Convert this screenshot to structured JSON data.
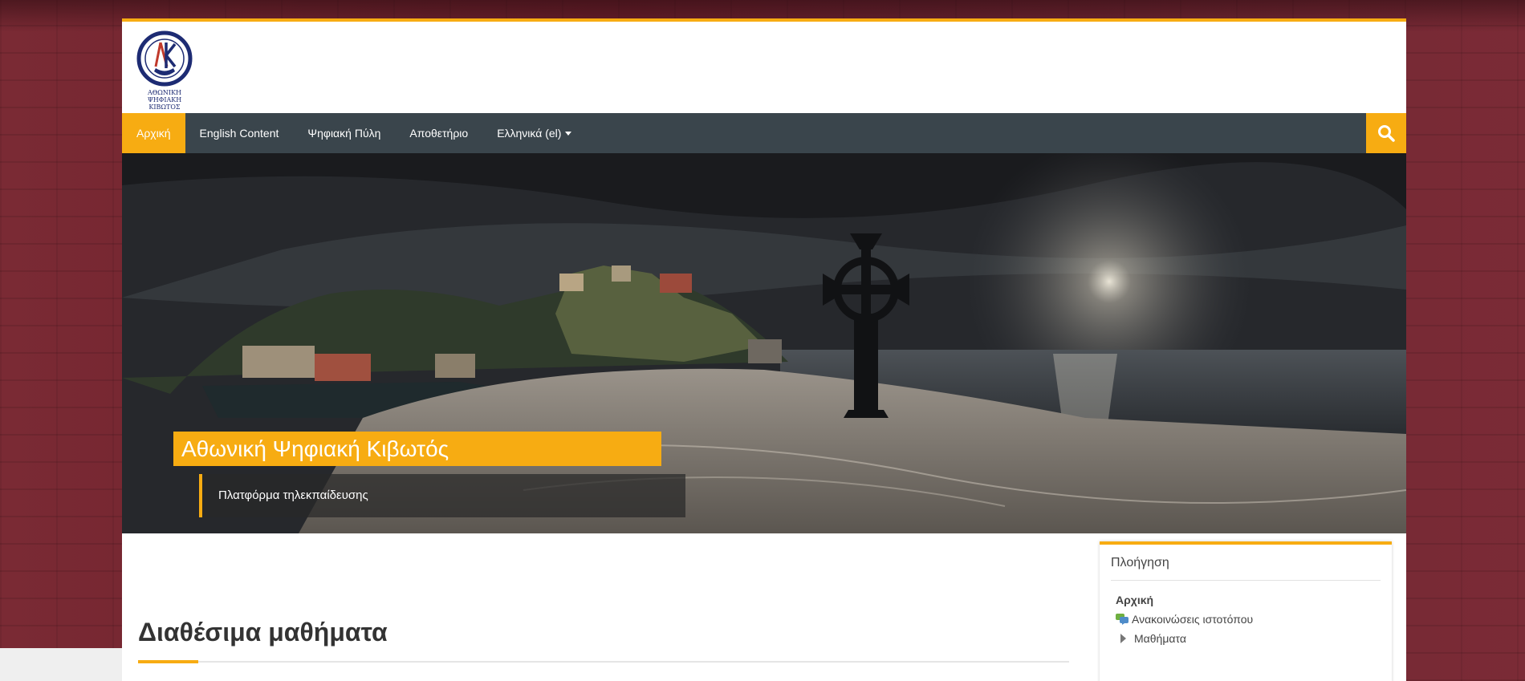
{
  "logo": {
    "line1": "ΑΘΩΝΙΚΗ",
    "line2": "ΨΗΦΙΑΚΗ ΚΙΒΩΤΟΣ"
  },
  "nav": {
    "items": [
      {
        "label": "Αρχική"
      },
      {
        "label": "English Content"
      },
      {
        "label": "Ψηφιακή Πύλη"
      },
      {
        "label": "Αποθετήριο"
      },
      {
        "label": "Ελληνικά (el)"
      }
    ],
    "search_icon": "search-icon"
  },
  "hero": {
    "title": "Αθωνική Ψηφιακή Κιβωτός",
    "subtitle": "Πλατφόρμα τηλεκπαίδευσης"
  },
  "main": {
    "title": "Διαθέσιμα μαθήματα"
  },
  "navigation_block": {
    "title": "Πλοήγηση",
    "home": "Αρχική",
    "announcements": "Ανακοινώσεις ιστοτόπου",
    "courses": "Μαθήματα"
  },
  "colors": {
    "accent": "#f7ac12",
    "navbar": "#3a454c",
    "background": "#6e2430"
  }
}
